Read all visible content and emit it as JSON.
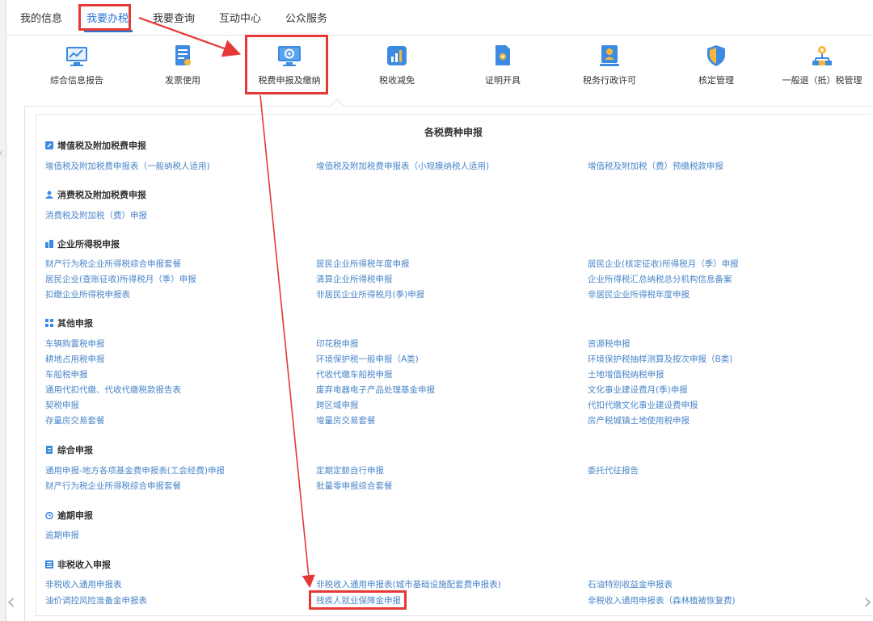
{
  "topnav": {
    "tabs": [
      "我的信息",
      "我要办税",
      "我要查询",
      "互动中心",
      "公众服务"
    ]
  },
  "icons": [
    "综合信息报告",
    "发票使用",
    "税费申报及缴纳",
    "税收减免",
    "证明开具",
    "税务行政许可",
    "核定管理",
    "一般退（抵）税管理"
  ],
  "panel": {
    "title": "各税费种申报",
    "sections": [
      {
        "title": "增值税及附加税费申报",
        "links": [
          "增值税及附加税费申报表（一般纳税人适用)",
          "增值税及附加税费申报表（小规模纳税人适用)",
          "增值税及附加税（费）预缴税款申报"
        ]
      },
      {
        "title": "消费税及附加税费申报",
        "links": [
          "消费税及附加税（费）申报"
        ]
      },
      {
        "title": "企业所得税申报",
        "links": [
          "财产行为税企业所得税综合申报套餐",
          "居民企业所得税年度申报",
          "居民企业(核定征收)所得税月（季）申报",
          "居民企业(查账征收)所得税月（季）申报",
          "清算企业所得税申报",
          "企业所得税汇总纳税总分机构信息备案",
          "扣缴企业所得税申报表",
          "非居民企业所得税月(季)申报",
          "非居民企业所得税年度申报"
        ]
      },
      {
        "title": "其他申报",
        "links": [
          "车辆购置税申报",
          "印花税申报",
          "资源税申报",
          "耕地占用税申报",
          "环境保护税一般申报（A类)",
          "环境保护税抽样测算及按次申报（B类)",
          "车船税申报",
          "代收代缴车船税申报",
          "土地增值税纳税申报",
          "通用代扣代缴、代收代缴税款报告表",
          "废弃电器电子产品处理基金申报",
          "文化事业建设费月(季)申报",
          "契税申报",
          "跨区域申报",
          "代扣代缴文化事业建设费申报",
          "存量房交易套餐",
          "增量房交易套餐",
          "房产税城镇土地使用税申报"
        ]
      },
      {
        "title": "综合申报",
        "links": [
          "通用申报-地方各项基金费申报表(工会经费)申报",
          "定期定额自行申报",
          "委托代征报告",
          "财产行为税企业所得税综合申报套餐",
          "批量零申报综合套餐"
        ]
      },
      {
        "title": "逾期申报",
        "links": [
          "逾期申报"
        ]
      },
      {
        "title": "非税收入申报",
        "links": [
          "非税收入通用申报表",
          "非税收入通用申报表(城市基础设施配套费申报表)",
          "石油特别收益金申报表",
          "油价调控风险准备金申报表",
          "残疾人就业保障金申报",
          "非税收入通用申报表（森林植被恢复费)"
        ]
      }
    ]
  },
  "colors": {
    "accent": "#2b74d6",
    "link": "#4a86c8",
    "highlight": "#e53935"
  },
  "nav_arrows": {
    "left": "‹",
    "right": "›"
  }
}
